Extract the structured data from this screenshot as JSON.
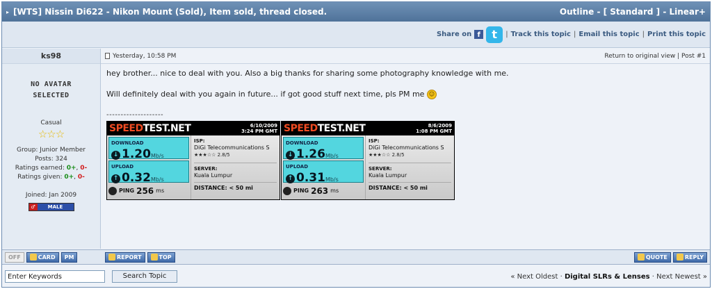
{
  "thread": {
    "title": "[WTS] Nissin Di622 - Nikon Mount (Sold), Item sold, thread closed.",
    "modes": "Outline - [ Standard ] - Linear+"
  },
  "share": {
    "label": "Share on",
    "facebook": "f",
    "twitter": "t",
    "links": [
      "Track this topic",
      "Email this topic",
      "Print this topic"
    ]
  },
  "user": {
    "name": "ks98",
    "no_avatar_line1": "NO AVATAR",
    "no_avatar_line2": "SELECTED",
    "rank": "Casual",
    "stars": "☆☆☆",
    "group": "Group: Junior Member",
    "posts": "Posts: 324",
    "ratings_earned_label": "Ratings earned:",
    "ratings_earned_pos": "0+",
    "ratings_earned_neg": "0-",
    "ratings_given_label": "Ratings given:",
    "ratings_given_pos": "0+",
    "ratings_given_neg": "0-",
    "joined": "Joined: Jan 2009",
    "gender": "MALE",
    "gender_symbol": "♂"
  },
  "post": {
    "date": "Yesterday, 10:58 PM",
    "return_link": "Return to original view",
    "post_number": "Post #1",
    "line1": "hey brother... nice to deal with you. Also a big thanks for sharing some photography knowledge with me.",
    "line2": "Will definitely deal with you again in future... if got good stuff next time, pls PM me",
    "signature_rule": "--------------------"
  },
  "speedtests": [
    {
      "logo_a": "SPEED",
      "logo_b": "TEST.NET",
      "date": "6/10/2009",
      "time": "3:24 PM GMT",
      "download_label": "DOWNLOAD",
      "download": "1.20",
      "upload_label": "UPLOAD",
      "upload": "0.32",
      "unit": "Mb/s",
      "ping_label": "PING",
      "ping": "256",
      "ping_unit": "ms",
      "isp_label": "ISP:",
      "isp": "DiGi Telecommunications S",
      "rating": "★★★☆☆ 2.8/5",
      "server_label": "SERVER:",
      "server": "Kuala Lumpur",
      "distance_label": "DISTANCE:",
      "distance": "< 50 mi"
    },
    {
      "logo_a": "SPEED",
      "logo_b": "TEST.NET",
      "date": "8/6/2009",
      "time": "1:08 PM GMT",
      "download_label": "DOWNLOAD",
      "download": "1.26",
      "upload_label": "UPLOAD",
      "upload": "0.31",
      "unit": "Mb/s",
      "ping_label": "PING",
      "ping": "263",
      "ping_unit": "ms",
      "isp_label": "ISP:",
      "isp": "DiGi Telecommunications S",
      "rating": "★★★☆☆ 2.8/5",
      "server_label": "SERVER:",
      "server": "Kuala Lumpur",
      "distance_label": "DISTANCE:",
      "distance": "< 50 mi"
    }
  ],
  "actions": {
    "off": "OFF",
    "card": "CARD",
    "pm": "PM",
    "report": "REPORT",
    "top": "TOP",
    "quote": "QUOTE",
    "reply": "REPLY"
  },
  "bottom": {
    "search_placeholder": "Enter Keywords",
    "search_value": "Enter Keywords",
    "search_button": "Search Topic",
    "prev": "« Next Oldest",
    "forum": "Digital SLRs & Lenses",
    "next": "Next Newest »"
  },
  "colors": {
    "titlebar": "#5b7fa6",
    "accent": "#2a4e86",
    "speedtest_cyan": "#53d6df",
    "speedtest_orange": "#f04b22"
  }
}
